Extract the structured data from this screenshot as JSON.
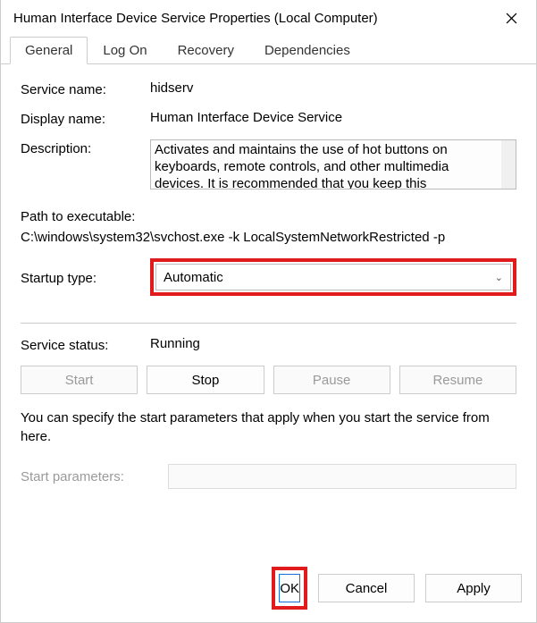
{
  "window": {
    "title": "Human Interface Device Service Properties (Local Computer)"
  },
  "tabs": {
    "general": "General",
    "logon": "Log On",
    "recovery": "Recovery",
    "dependencies": "Dependencies"
  },
  "labels": {
    "service_name": "Service name:",
    "display_name": "Display name:",
    "description": "Description:",
    "path_label": "Path to executable:",
    "startup_type": "Startup type:",
    "service_status": "Service status:",
    "start_params": "Start parameters:"
  },
  "values": {
    "service_name": "hidserv",
    "display_name": "Human Interface Device Service",
    "description": "Activates and maintains the use of hot buttons on keyboards, remote controls, and other multimedia devices. It is recommended that you keep this",
    "path": "C:\\windows\\system32\\svchost.exe -k LocalSystemNetworkRestricted -p",
    "startup_type": "Automatic",
    "service_status": "Running"
  },
  "buttons": {
    "start": "Start",
    "stop": "Stop",
    "pause": "Pause",
    "resume": "Resume",
    "ok": "OK",
    "cancel": "Cancel",
    "apply": "Apply"
  },
  "hint": "You can specify the start parameters that apply when you start the service from here."
}
